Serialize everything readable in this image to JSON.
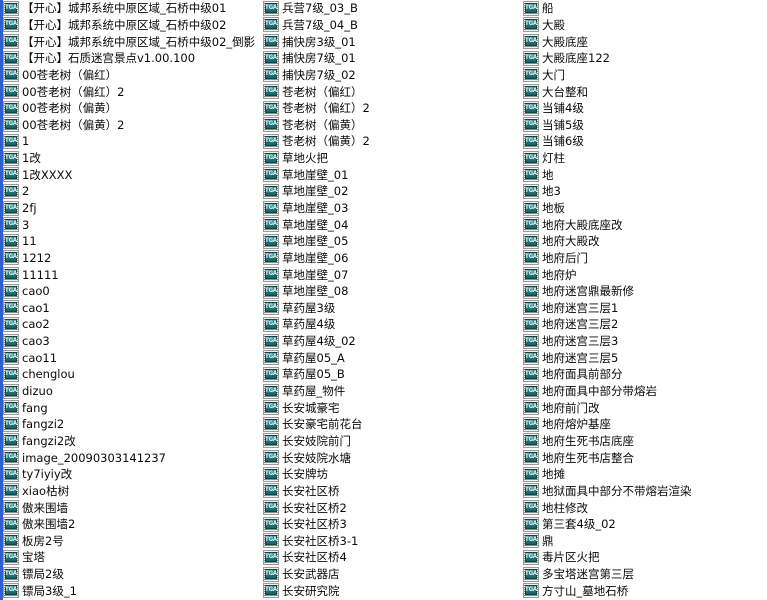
{
  "view": {
    "mode": "list",
    "background_color": "#ffffff",
    "text_color": "#0a0a0a",
    "accent_color": "#2d5fd0",
    "icon_label": "TGA",
    "icon_color": "#247a7a",
    "column_count": 3
  },
  "columns": [
    {
      "index": 1,
      "items": [
        {
          "name": "【开心】城邦系统中原区域_石桥中级01",
          "icon": "tga-file-icon"
        },
        {
          "name": "【开心】城邦系统中原区域_石桥中级02",
          "icon": "tga-file-icon"
        },
        {
          "name": "【开心】城邦系统中原区域_石桥中级02_倒影",
          "icon": "tga-file-icon"
        },
        {
          "name": "【开心】石质迷宫景点v1.00.100",
          "icon": "tga-file-icon"
        },
        {
          "name": "00苍老树（偏红）",
          "icon": "tga-file-icon"
        },
        {
          "name": "00苍老树（偏红）2",
          "icon": "tga-file-icon"
        },
        {
          "name": "00苍老树（偏黄）",
          "icon": "tga-file-icon"
        },
        {
          "name": "00苍老树（偏黄）2",
          "icon": "tga-file-icon"
        },
        {
          "name": "1",
          "icon": "tga-file-icon"
        },
        {
          "name": "1改",
          "icon": "tga-file-icon"
        },
        {
          "name": "1改XXXX",
          "icon": "tga-file-icon"
        },
        {
          "name": "2",
          "icon": "tga-file-icon"
        },
        {
          "name": "2fj",
          "icon": "tga-file-icon"
        },
        {
          "name": "3",
          "icon": "tga-file-icon"
        },
        {
          "name": "11",
          "icon": "tga-file-icon"
        },
        {
          "name": "1212",
          "icon": "tga-file-icon"
        },
        {
          "name": "11111",
          "icon": "tga-file-icon"
        },
        {
          "name": "cao0",
          "icon": "tga-file-icon"
        },
        {
          "name": "cao1",
          "icon": "tga-file-icon"
        },
        {
          "name": "cao2",
          "icon": "tga-file-icon"
        },
        {
          "name": "cao3",
          "icon": "tga-file-icon"
        },
        {
          "name": "cao11",
          "icon": "tga-file-icon"
        },
        {
          "name": "chenglou",
          "icon": "tga-file-icon"
        },
        {
          "name": "dizuo",
          "icon": "tga-file-icon"
        },
        {
          "name": "fang",
          "icon": "tga-file-icon"
        },
        {
          "name": "fangzi2",
          "icon": "tga-file-icon"
        },
        {
          "name": "fangzi2改",
          "icon": "tga-file-icon"
        },
        {
          "name": "image_20090303141237",
          "icon": "tga-file-icon"
        },
        {
          "name": "ty7iyiy改",
          "icon": "tga-file-icon"
        },
        {
          "name": "xiao枯树",
          "icon": "tga-file-icon"
        },
        {
          "name": "傲来围墙",
          "icon": "tga-file-icon"
        },
        {
          "name": "傲来围墙2",
          "icon": "tga-file-icon"
        },
        {
          "name": "板房2号",
          "icon": "tga-file-icon"
        },
        {
          "name": "宝塔",
          "icon": "tga-file-icon"
        },
        {
          "name": "镖局2级",
          "icon": "tga-file-icon"
        },
        {
          "name": "镖局3级_1",
          "icon": "tga-file-icon"
        }
      ]
    },
    {
      "index": 2,
      "items": [
        {
          "name": "兵营7级_03_B",
          "icon": "tga-file-icon"
        },
        {
          "name": "兵营7级_04_B",
          "icon": "tga-file-icon"
        },
        {
          "name": "捕快房3级_01",
          "icon": "tga-file-icon"
        },
        {
          "name": "捕快房7级_01",
          "icon": "tga-file-icon"
        },
        {
          "name": "捕快房7级_02",
          "icon": "tga-file-icon"
        },
        {
          "name": "苍老树（偏红）",
          "icon": "tga-file-icon"
        },
        {
          "name": "苍老树（偏红）2",
          "icon": "tga-file-icon"
        },
        {
          "name": "苍老树（偏黄）",
          "icon": "tga-file-icon"
        },
        {
          "name": "苍老树（偏黄）2",
          "icon": "tga-file-icon"
        },
        {
          "name": "草地火把",
          "icon": "tga-file-icon"
        },
        {
          "name": "草地崖壁_01",
          "icon": "tga-file-icon"
        },
        {
          "name": "草地崖壁_02",
          "icon": "tga-file-icon"
        },
        {
          "name": "草地崖壁_03",
          "icon": "tga-file-icon"
        },
        {
          "name": "草地崖壁_04",
          "icon": "tga-file-icon"
        },
        {
          "name": "草地崖壁_05",
          "icon": "tga-file-icon"
        },
        {
          "name": "草地崖壁_06",
          "icon": "tga-file-icon"
        },
        {
          "name": "草地崖壁_07",
          "icon": "tga-file-icon"
        },
        {
          "name": "草地崖壁_08",
          "icon": "tga-file-icon"
        },
        {
          "name": "草药屋3级",
          "icon": "tga-file-icon"
        },
        {
          "name": "草药屋4级",
          "icon": "tga-file-icon"
        },
        {
          "name": "草药屋4级_02",
          "icon": "tga-file-icon"
        },
        {
          "name": "草药屋05_A",
          "icon": "tga-file-icon"
        },
        {
          "name": "草药屋05_B",
          "icon": "tga-file-icon"
        },
        {
          "name": "草药屋_物件",
          "icon": "tga-file-icon"
        },
        {
          "name": "长安城豪宅",
          "icon": "tga-file-icon"
        },
        {
          "name": "长安豪宅前花台",
          "icon": "tga-file-icon"
        },
        {
          "name": "长安妓院前门",
          "icon": "tga-file-icon"
        },
        {
          "name": "长安妓院水塘",
          "icon": "tga-file-icon"
        },
        {
          "name": "长安牌坊",
          "icon": "tga-file-icon"
        },
        {
          "name": "长安社区桥",
          "icon": "tga-file-icon"
        },
        {
          "name": "长安社区桥2",
          "icon": "tga-file-icon"
        },
        {
          "name": "长安社区桥3",
          "icon": "tga-file-icon"
        },
        {
          "name": "长安社区桥3-1",
          "icon": "tga-file-icon"
        },
        {
          "name": "长安社区桥4",
          "icon": "tga-file-icon"
        },
        {
          "name": "长安武器店",
          "icon": "tga-file-icon"
        },
        {
          "name": "长安研究院",
          "icon": "tga-file-icon"
        }
      ]
    },
    {
      "index": 3,
      "items": [
        {
          "name": "船",
          "icon": "tga-file-icon"
        },
        {
          "name": "大殿",
          "icon": "tga-file-icon"
        },
        {
          "name": "大殿底座",
          "icon": "tga-file-icon"
        },
        {
          "name": "大殿底座122",
          "icon": "tga-file-icon"
        },
        {
          "name": "大门",
          "icon": "tga-file-icon"
        },
        {
          "name": "大台整和",
          "icon": "tga-file-icon"
        },
        {
          "name": "当铺4级",
          "icon": "tga-file-icon"
        },
        {
          "name": "当铺5级",
          "icon": "tga-file-icon"
        },
        {
          "name": "当铺6级",
          "icon": "tga-file-icon"
        },
        {
          "name": "灯柱",
          "icon": "tga-file-icon"
        },
        {
          "name": "地",
          "icon": "tga-file-icon"
        },
        {
          "name": "地3",
          "icon": "tga-file-icon"
        },
        {
          "name": "地板",
          "icon": "tga-file-icon"
        },
        {
          "name": "地府大殿底座改",
          "icon": "tga-file-icon"
        },
        {
          "name": "地府大殿改",
          "icon": "tga-file-icon"
        },
        {
          "name": "地府后门",
          "icon": "tga-file-icon"
        },
        {
          "name": "地府炉",
          "icon": "tga-file-icon"
        },
        {
          "name": "地府迷宫鼎最新修",
          "icon": "tga-file-icon"
        },
        {
          "name": "地府迷宫三层1",
          "icon": "tga-file-icon"
        },
        {
          "name": "地府迷宫三层2",
          "icon": "tga-file-icon"
        },
        {
          "name": "地府迷宫三层3",
          "icon": "tga-file-icon"
        },
        {
          "name": "地府迷宫三层5",
          "icon": "tga-file-icon"
        },
        {
          "name": "地府面具前部分",
          "icon": "tga-file-icon"
        },
        {
          "name": "地府面具中部分带熔岩",
          "icon": "tga-file-icon"
        },
        {
          "name": "地府前门改",
          "icon": "tga-file-icon"
        },
        {
          "name": "地府熔炉基座",
          "icon": "tga-file-icon"
        },
        {
          "name": "地府生死书店底座",
          "icon": "tga-file-icon"
        },
        {
          "name": "地府生死书店整合",
          "icon": "tga-file-icon"
        },
        {
          "name": "地摊",
          "icon": "tga-file-icon"
        },
        {
          "name": "地狱面具中部分不带熔岩渲染",
          "icon": "tga-file-icon"
        },
        {
          "name": "地柱修改",
          "icon": "tga-file-icon"
        },
        {
          "name": "第三套4级_02",
          "icon": "tga-file-icon"
        },
        {
          "name": "鼎",
          "icon": "tga-file-icon"
        },
        {
          "name": "毒片区火把",
          "icon": "tga-file-icon"
        },
        {
          "name": "多宝塔迷宫第三层",
          "icon": "tga-file-icon"
        },
        {
          "name": "方寸山_墓地石桥",
          "icon": "tga-file-icon"
        }
      ]
    }
  ]
}
